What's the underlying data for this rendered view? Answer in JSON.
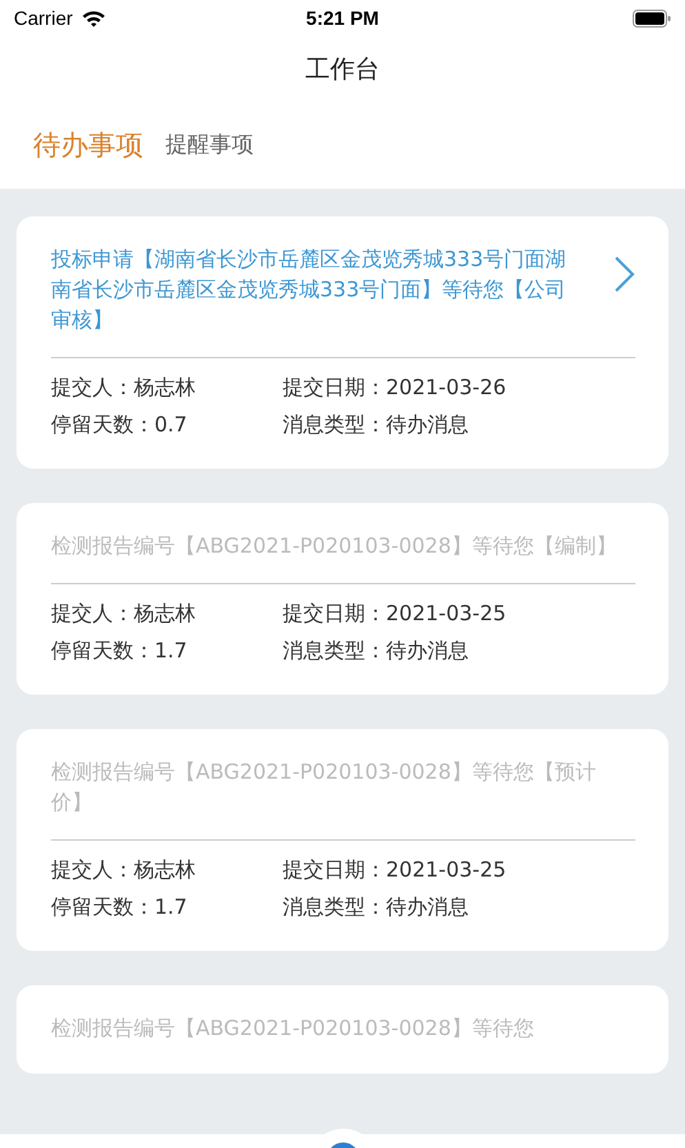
{
  "status_bar": {
    "carrier": "Carrier",
    "time": "5:21 PM"
  },
  "nav": {
    "title": "工作台"
  },
  "tabs": [
    {
      "label": "待办事项",
      "selected": true
    },
    {
      "label": "提醒事项",
      "selected": false
    }
  ],
  "cards": [
    {
      "title": "投标申请【湖南省长沙市岳麓区金茂览秀城333号门面湖南省长沙市岳麓区金茂览秀城333号门面】等待您【公司审核】",
      "active": true,
      "submitter_label": "提交人：",
      "submitter": "杨志林",
      "date_label": "提交日期：",
      "date": "2021-03-26",
      "days_label": "停留天数：",
      "days": "0.7",
      "type_label": "消息类型：",
      "type": "待办消息"
    },
    {
      "title": "检测报告编号【ABG2021-P020103-0028】等待您【编制】",
      "active": false,
      "submitter_label": "提交人：",
      "submitter": "杨志林",
      "date_label": "提交日期：",
      "date": "2021-03-25",
      "days_label": "停留天数：",
      "days": "1.7",
      "type_label": "消息类型：",
      "type": "待办消息"
    },
    {
      "title": "检测报告编号【ABG2021-P020103-0028】等待您【预计价】",
      "active": false,
      "submitter_label": "提交人：",
      "submitter": "杨志林",
      "date_label": "提交日期：",
      "date": "2021-03-25",
      "days_label": "停留天数：",
      "days": "1.7",
      "type_label": "消息类型：",
      "type": "待办消息"
    },
    {
      "title": "检测报告编号【ABG2021-P020103-0028】等待您",
      "active": false
    }
  ]
}
